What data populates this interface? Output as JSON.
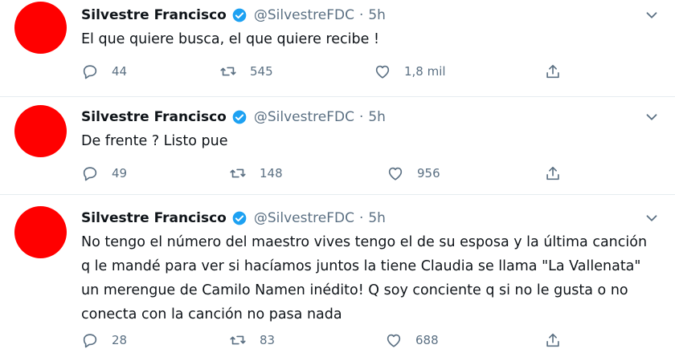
{
  "colors": {
    "avatar": "#ff0000",
    "verified": "#1da1f2",
    "muted": "#5b7083",
    "divider": "#e6ecf0"
  },
  "tweets": [
    {
      "author": "Silvestre Francisco",
      "handle": "@SilvestreFDC",
      "separator": "·",
      "time": "5h",
      "verified": true,
      "text": "El que quiere busca, el que quiere recibe !",
      "replies": "44",
      "retweets": "545",
      "likes": "1,8 mil",
      "icons": [
        "reply-icon",
        "retweet-icon",
        "like-icon",
        "share-icon"
      ]
    },
    {
      "author": "Silvestre Francisco",
      "handle": "@SilvestreFDC",
      "separator": "·",
      "time": "5h",
      "verified": true,
      "text": "De frente ? Listo pue",
      "replies": "49",
      "retweets": "148",
      "likes": "956",
      "icons": [
        "reply-icon",
        "retweet-icon",
        "like-icon",
        "share-icon"
      ]
    },
    {
      "author": "Silvestre Francisco",
      "handle": "@SilvestreFDC",
      "separator": "·",
      "time": "5h",
      "verified": true,
      "text": "No tengo el número del maestro vives tengo el de su esposa y la última canción q le mandé para ver si hacíamos juntos la tiene Claudia se llama \"La Vallenata\" un merengue de Camilo Namen inédito! Q soy conciente q si no le gusta o no conecta con la canción no pasa nada",
      "replies": "28",
      "retweets": "83",
      "likes": "688",
      "icons": [
        "reply-icon",
        "retweet-icon",
        "like-icon",
        "share-icon"
      ]
    }
  ]
}
